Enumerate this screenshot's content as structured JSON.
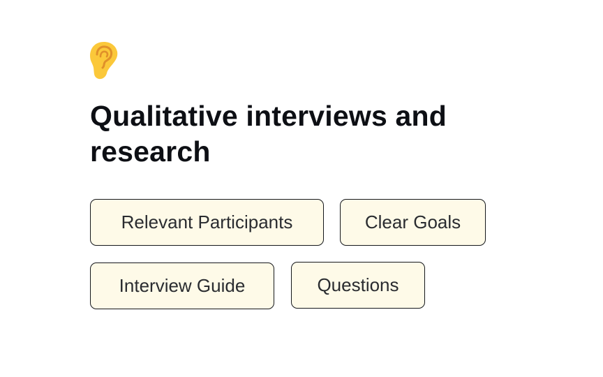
{
  "header": {
    "icon": "ear-icon",
    "title": "Qualitative interviews and research"
  },
  "tags": [
    {
      "label": "Relevant Participants"
    },
    {
      "label": "Clear Goals"
    },
    {
      "label": "Interview Guide"
    },
    {
      "label": "Questions"
    }
  ],
  "colors": {
    "tag_background": "#fefae8",
    "tag_border": "#15171b",
    "icon_fill": "#fbc83a",
    "icon_stroke": "#e0902a",
    "title_text": "#0d0f14"
  }
}
